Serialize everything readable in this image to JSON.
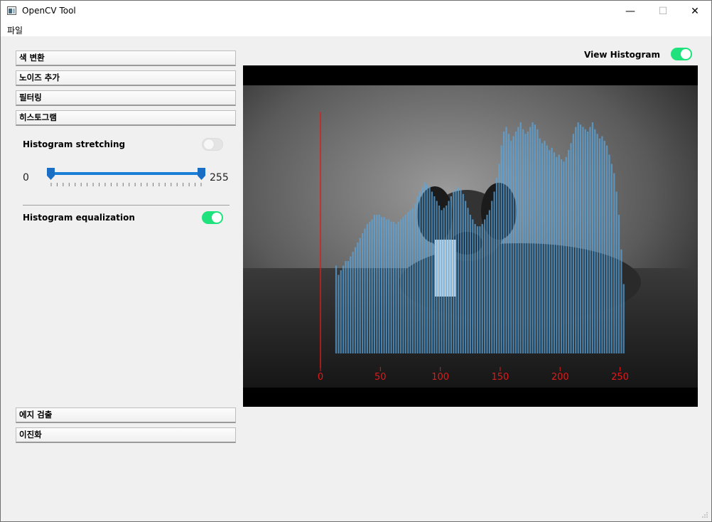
{
  "window": {
    "title": "OpenCV Tool",
    "minimize": "—",
    "maximize": "☐",
    "close": "✕"
  },
  "menu": {
    "file": "파일"
  },
  "sidebar": {
    "sections_top": [
      "색 변환",
      "노이즈 추가",
      "필터링",
      "히스토그램"
    ],
    "sections_bottom": [
      "에지 검출",
      "이진화"
    ],
    "histogram_panel": {
      "stretching_label": "Histogram stretching",
      "stretching_on": false,
      "range_min": "0",
      "range_max": "255",
      "equalization_label": "Histogram equalization",
      "equalization_on": true
    }
  },
  "viewer": {
    "view_histogram_label": "View Histogram",
    "view_histogram_on": true,
    "image_description": "grayscale photo of a dog lying on grass with histogram overlay",
    "colors": {
      "bar": "#5aa8e0",
      "axis": "#e01a1a",
      "toggle_on": "#1fe27c",
      "slider": "#1a7fd6"
    }
  },
  "chart_data": {
    "type": "bar",
    "xlim": [
      0,
      255
    ],
    "xticks": [
      "0",
      "50",
      "100",
      "150",
      "200",
      "250"
    ],
    "bars": [
      [
        13,
        0.38
      ],
      [
        15,
        0.34
      ],
      [
        17,
        0.36
      ],
      [
        19,
        0.38
      ],
      [
        21,
        0.4
      ],
      [
        23,
        0.4
      ],
      [
        25,
        0.42
      ],
      [
        27,
        0.44
      ],
      [
        29,
        0.46
      ],
      [
        31,
        0.48
      ],
      [
        33,
        0.5
      ],
      [
        35,
        0.52
      ],
      [
        37,
        0.54
      ],
      [
        39,
        0.56
      ],
      [
        41,
        0.57
      ],
      [
        43,
        0.58
      ],
      [
        45,
        0.6
      ],
      [
        47,
        0.6
      ],
      [
        49,
        0.6
      ],
      [
        51,
        0.59
      ],
      [
        53,
        0.59
      ],
      [
        55,
        0.58
      ],
      [
        57,
        0.58
      ],
      [
        59,
        0.57
      ],
      [
        61,
        0.57
      ],
      [
        63,
        0.56
      ],
      [
        65,
        0.57
      ],
      [
        67,
        0.58
      ],
      [
        69,
        0.59
      ],
      [
        71,
        0.6
      ],
      [
        73,
        0.61
      ],
      [
        75,
        0.62
      ],
      [
        77,
        0.63
      ],
      [
        79,
        0.65
      ],
      [
        81,
        0.68
      ],
      [
        83,
        0.7
      ],
      [
        85,
        0.72
      ],
      [
        87,
        0.74
      ],
      [
        89,
        0.73
      ],
      [
        91,
        0.72
      ],
      [
        93,
        0.7
      ],
      [
        95,
        0.68
      ],
      [
        97,
        0.66
      ],
      [
        99,
        0.64
      ],
      [
        101,
        0.62
      ],
      [
        103,
        0.63
      ],
      [
        105,
        0.64
      ],
      [
        107,
        0.66
      ],
      [
        109,
        0.68
      ],
      [
        111,
        0.7
      ],
      [
        113,
        0.71
      ],
      [
        115,
        0.72
      ],
      [
        117,
        0.71
      ],
      [
        119,
        0.69
      ],
      [
        121,
        0.66
      ],
      [
        123,
        0.63
      ],
      [
        125,
        0.6
      ],
      [
        127,
        0.58
      ],
      [
        129,
        0.56
      ],
      [
        131,
        0.55
      ],
      [
        133,
        0.55
      ],
      [
        135,
        0.56
      ],
      [
        137,
        0.58
      ],
      [
        139,
        0.6
      ],
      [
        141,
        0.62
      ],
      [
        143,
        0.66
      ],
      [
        145,
        0.7
      ],
      [
        147,
        0.76
      ],
      [
        149,
        0.82
      ],
      [
        151,
        0.9
      ],
      [
        153,
        0.96
      ],
      [
        155,
        0.98
      ],
      [
        157,
        0.95
      ],
      [
        159,
        0.92
      ],
      [
        161,
        0.94
      ],
      [
        163,
        0.96
      ],
      [
        165,
        0.98
      ],
      [
        167,
        1.0
      ],
      [
        169,
        0.97
      ],
      [
        171,
        0.95
      ],
      [
        173,
        0.96
      ],
      [
        175,
        0.98
      ],
      [
        177,
        1.0
      ],
      [
        179,
        0.99
      ],
      [
        181,
        0.97
      ],
      [
        183,
        0.93
      ],
      [
        185,
        0.91
      ],
      [
        187,
        0.92
      ],
      [
        189,
        0.9
      ],
      [
        191,
        0.88
      ],
      [
        193,
        0.89
      ],
      [
        195,
        0.87
      ],
      [
        197,
        0.85
      ],
      [
        199,
        0.86
      ],
      [
        201,
        0.84
      ],
      [
        203,
        0.83
      ],
      [
        205,
        0.85
      ],
      [
        207,
        0.88
      ],
      [
        209,
        0.91
      ],
      [
        211,
        0.95
      ],
      [
        213,
        0.98
      ],
      [
        215,
        1.0
      ],
      [
        217,
        0.99
      ],
      [
        219,
        0.98
      ],
      [
        221,
        0.97
      ],
      [
        223,
        0.96
      ],
      [
        225,
        0.98
      ],
      [
        227,
        1.0
      ],
      [
        229,
        0.97
      ],
      [
        231,
        0.95
      ],
      [
        233,
        0.93
      ],
      [
        235,
        0.94
      ],
      [
        237,
        0.92
      ],
      [
        239,
        0.9
      ],
      [
        241,
        0.86
      ],
      [
        243,
        0.82
      ],
      [
        245,
        0.78
      ],
      [
        247,
        0.7
      ],
      [
        249,
        0.6
      ],
      [
        251,
        0.45
      ],
      [
        253,
        0.3
      ]
    ]
  }
}
